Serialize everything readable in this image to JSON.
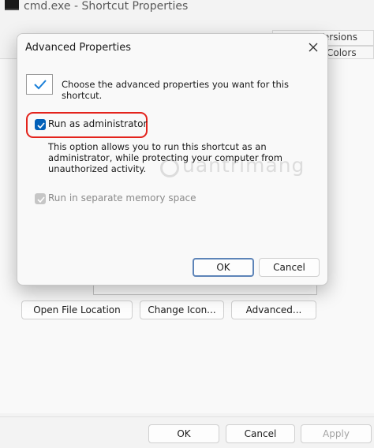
{
  "window": {
    "title": "cmd.exe - Shortcut Properties",
    "tabs": [
      {
        "label": "Versions"
      },
      {
        "label": "Colors"
      }
    ],
    "buttons": {
      "open_file_location": "Open File Location",
      "change_icon": "Change Icon...",
      "advanced": "Advanced..."
    },
    "footer": {
      "ok": "OK",
      "cancel": "Cancel",
      "apply": "Apply"
    }
  },
  "dialog": {
    "title": "Advanced Properties",
    "intro": "Choose the advanced properties you want for this shortcut.",
    "run_as_admin": {
      "label": "Run as administrator",
      "checked": true
    },
    "description": "This option allows you to run this shortcut as an administrator, while protecting your computer from unauthorized activity.",
    "separate_memory": {
      "label": "Run in separate memory space",
      "checked": true,
      "disabled": true
    },
    "ok": "OK",
    "cancel": "Cancel"
  },
  "colors": {
    "accent": "#005fb8",
    "highlight": "#e3231c"
  }
}
